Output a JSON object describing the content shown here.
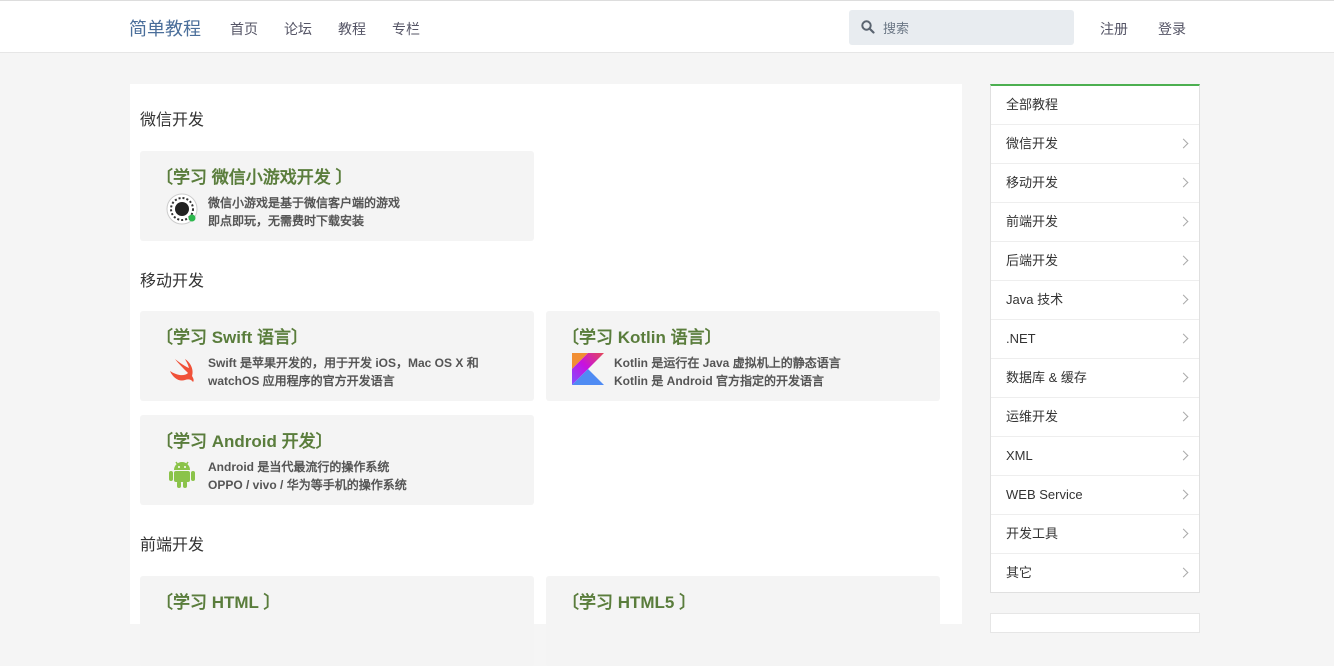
{
  "header": {
    "brand": "简单教程",
    "nav": [
      "首页",
      "论坛",
      "教程",
      "专栏"
    ],
    "search_placeholder": "搜索",
    "register": "注册",
    "login": "登录"
  },
  "sections": [
    {
      "title": "微信开发",
      "cards": [
        {
          "title": "〔学习 微信小游戏开发 〕",
          "icon": "wechat-minigame-icon",
          "line1": "微信小游戏是基于微信客户端的游戏",
          "line2": "即点即玩，无需费时下载安装"
        }
      ]
    },
    {
      "title": "移动开发",
      "cards": [
        {
          "title": "〔学习 Swift 语言〕",
          "icon": "swift-icon",
          "line1": "Swift 是苹果开发的，用于开发 iOS，Mac OS X 和",
          "line2": "watchOS 应用程序的官方开发语言"
        },
        {
          "title": "〔学习 Kotlin 语言〕",
          "icon": "kotlin-icon",
          "line1": "Kotlin 是运行在 Java 虚拟机上的静态语言",
          "line2": "Kotlin 是 Android 官方指定的开发语言"
        },
        {
          "title": "〔学习 Android 开发〕",
          "icon": "android-icon",
          "line1": "Android 是当代最流行的操作系统",
          "line2": "OPPO / vivo / 华为等手机的操作系统"
        }
      ]
    },
    {
      "title": "前端开发",
      "cards": [
        {
          "title": "〔学习 HTML 〕",
          "icon": "html-icon"
        },
        {
          "title": "〔学习 HTML5 〕",
          "icon": "html5-icon"
        }
      ]
    }
  ],
  "sidebar": {
    "items": [
      "全部教程",
      "微信开发",
      "移动开发",
      "前端开发",
      "后端开发",
      "Java 技术",
      ".NET",
      "数据库 & 缓存",
      "运维开发",
      "XML",
      "WEB Service",
      "开发工具",
      "其它"
    ]
  },
  "colors": {
    "accent_green": "#4caf50",
    "card_title": "#5a7d3c",
    "brand": "#4a6e9a"
  }
}
